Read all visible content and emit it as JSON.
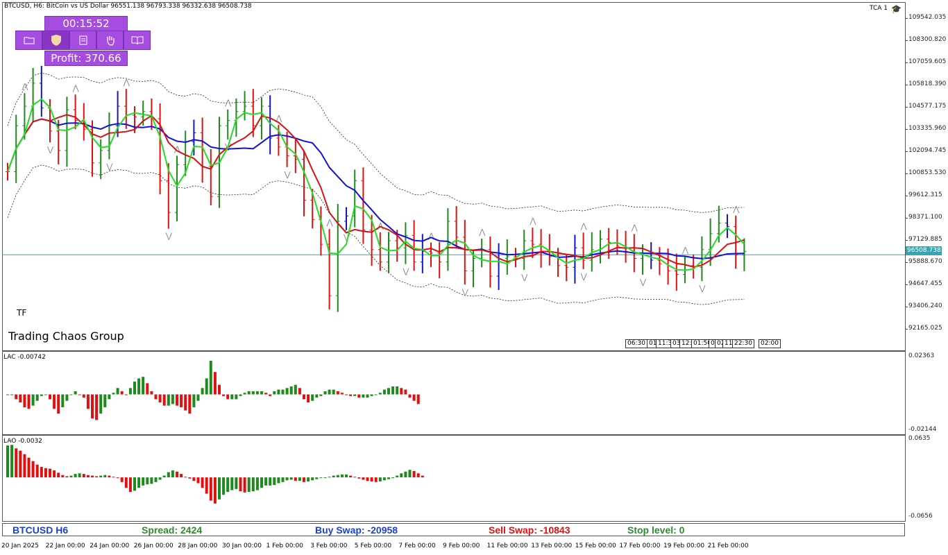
{
  "header": {
    "symbol_line": "BTCUSD, H6:  BitCoin vs US Dollar  96551.138 96793.338 96332.638 96508.738",
    "indicator_tag": "TCA 1"
  },
  "widget": {
    "timer": "00:15:52",
    "profit": "Profit: 370.66",
    "buttons": [
      "folder-icon",
      "shield-icon",
      "document-icon",
      "hand-icon",
      "book-icon"
    ]
  },
  "labels": {
    "tf": "TF",
    "brand": "Trading Chaos Group",
    "lac": "LAC -0.00742",
    "lao": "LAO -0.0032"
  },
  "price_axis": {
    "ticks": [
      "109542.035",
      "108300.820",
      "107059.605",
      "105818.390",
      "104577.175",
      "103335.960",
      "102094.745",
      "100853.530",
      "99612.315",
      "98371.100",
      "97129.885",
      "95888.670",
      "94647.455",
      "93406.240",
      "92165.025"
    ],
    "current": "96508.738"
  },
  "lac_axis": [
    "0.02363",
    "-0.02144"
  ],
  "lao_axis": [
    "0.0635",
    "-0.0656"
  ],
  "time_boxes": [
    "06:30",
    "01",
    "11:3",
    "03",
    "12:",
    "01:50",
    "03",
    "02:",
    "11:",
    "22:30",
    "02:00"
  ],
  "dates": [
    "20 Jan 2025",
    "22 Jan 00:00",
    "24 Jan 00:00",
    "26 Jan 00:00",
    "28 Jan 00:00",
    "30 Jan 00:00",
    "1 Feb 00:00",
    "3 Feb 00:00",
    "5 Feb 00:00",
    "7 Feb 00:00",
    "9 Feb 00:00",
    "11 Feb 00:00",
    "13 Feb 00:00",
    "15 Feb 00:00",
    "17 Feb 00:00",
    "19 Feb 00:00",
    "21 Feb 00:00"
  ],
  "status": {
    "symbol": "BTCUSD H6",
    "spread": "Spread: 2424",
    "buy_swap": "Buy Swap: -20958",
    "sell_swap": "Sell Swap: -10843",
    "stop_level": "Stop level: 0"
  },
  "colors": {
    "up": "#1e8a1e",
    "down": "#e01010",
    "neutral": "#1414c8",
    "green_ma": "#22dd22",
    "red_ma": "#dd1010",
    "blue_ma": "#1010dd",
    "price_line": "#31a6b4"
  },
  "chart_data": {
    "type": "candlestick",
    "ylim": [
      91500,
      110000
    ],
    "closes": [
      101200,
      103800,
      104900,
      106200,
      104800,
      103500,
      102400,
      104700,
      104100,
      103600,
      101700,
      102400,
      103800,
      104900,
      104400,
      104300,
      104600,
      104200,
      100700,
      98900,
      101600,
      102900,
      103400,
      101500,
      99800,
      103800,
      104100,
      104600,
      104900,
      103800,
      104900,
      103100,
      102600,
      102100,
      101900,
      99600,
      98500,
      97100,
      94200,
      98400,
      98700,
      100700,
      97900,
      96800,
      96100,
      97300,
      96900,
      97600,
      96100,
      96700,
      96600,
      96100,
      98400,
      97500,
      95600,
      96300,
      96800,
      95300,
      96300,
      96400,
      96300,
      97300,
      97100,
      96700,
      96400,
      95900,
      95800,
      96900,
      96200,
      96800,
      97400,
      97200,
      97000,
      96700,
      96300,
      96600,
      96200,
      96000,
      95600,
      95400,
      95900,
      95800,
      96800,
      97700,
      98300,
      98100,
      96500,
      96700
    ],
    "lac": [
      0.0,
      0.0,
      -0.003,
      -0.005,
      -0.008,
      -0.009,
      -0.007,
      -0.004,
      -0.001,
      0.0,
      -0.003,
      -0.009,
      -0.012,
      -0.008,
      -0.004,
      0.0,
      0.002,
      0.0,
      -0.002,
      -0.009,
      -0.015,
      -0.016,
      -0.012,
      -0.008,
      -0.003,
      0.001,
      0.004,
      0.002,
      0.0,
      0.004,
      0.008,
      0.01,
      0.011,
      0.007,
      0.002,
      -0.003,
      -0.005,
      -0.007,
      -0.007,
      -0.006,
      -0.007,
      -0.008,
      -0.01,
      -0.012,
      -0.008,
      -0.004,
      0.004,
      0.01,
      0.021,
      0.014,
      0.006,
      -0.001,
      -0.003,
      -0.003,
      -0.003,
      -0.001,
      0.001,
      0.002,
      0.002,
      0.002,
      0.002,
      0.001,
      -0.001,
      0.002,
      0.003,
      0.003,
      0.004,
      0.005,
      0.006,
      0.004,
      -0.003,
      -0.005,
      -0.004,
      -0.002,
      -0.001,
      0.002,
      0.003,
      0.003,
      0.002,
      0.001,
      0.0,
      -0.001,
      -0.001,
      -0.002,
      -0.002,
      -0.002,
      -0.001,
      0.0,
      0.001,
      0.003,
      0.004,
      0.005,
      0.005,
      0.004,
      0.003,
      -0.002,
      -0.004,
      -0.006
    ],
    "lao": [
      0.055,
      0.056,
      0.05,
      0.046,
      0.04,
      0.034,
      0.028,
      0.022,
      0.018,
      0.016,
      0.015,
      0.012,
      0.008,
      0.004,
      0.002,
      0.003,
      0.006,
      0.007,
      0.006,
      0.004,
      0.003,
      0.002,
      0.003,
      0.004,
      0.003,
      0.001,
      -0.001,
      -0.008,
      -0.018,
      -0.025,
      -0.023,
      -0.018,
      -0.014,
      -0.012,
      -0.011,
      -0.008,
      -0.004,
      0.003,
      0.009,
      0.012,
      0.01,
      0.006,
      0.001,
      -0.002,
      -0.006,
      -0.01,
      -0.018,
      -0.028,
      -0.04,
      -0.045,
      -0.038,
      -0.03,
      -0.025,
      -0.022,
      -0.02,
      -0.024,
      -0.026,
      -0.025,
      -0.024,
      -0.022,
      -0.018,
      -0.014,
      -0.014,
      -0.013,
      -0.01,
      -0.008,
      -0.005,
      -0.004,
      -0.006,
      -0.006,
      -0.008,
      -0.007,
      -0.005,
      -0.003,
      -0.001,
      0.0,
      0.001,
      0.003,
      0.004,
      0.005,
      0.005,
      0.003,
      0.001,
      -0.002,
      -0.004,
      -0.006,
      -0.007,
      -0.008,
      -0.007,
      -0.005,
      -0.003,
      -0.001,
      0.003,
      0.007,
      0.01,
      0.013,
      0.011,
      0.007,
      0.003
    ]
  }
}
